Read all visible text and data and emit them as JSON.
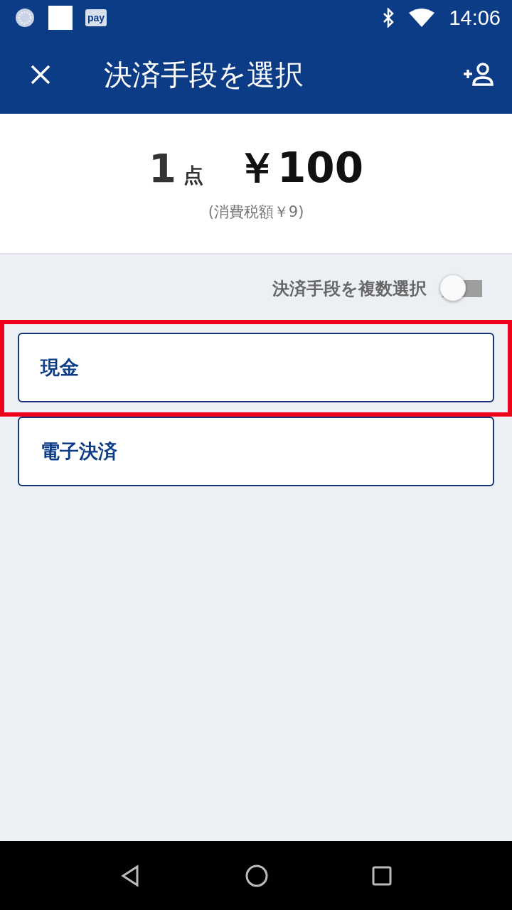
{
  "status_bar": {
    "pay_icon_text": "pay",
    "time": "14:06"
  },
  "app_bar": {
    "title": "決済手段を選択"
  },
  "summary": {
    "count": "1",
    "count_unit": "点",
    "total": "￥100",
    "tax": "(消費税額￥9)"
  },
  "multi_select": {
    "label": "決済手段を複数選択",
    "on": false
  },
  "options": [
    {
      "label": "現金",
      "highlighted": true
    },
    {
      "label": "電子決済",
      "highlighted": false
    }
  ]
}
